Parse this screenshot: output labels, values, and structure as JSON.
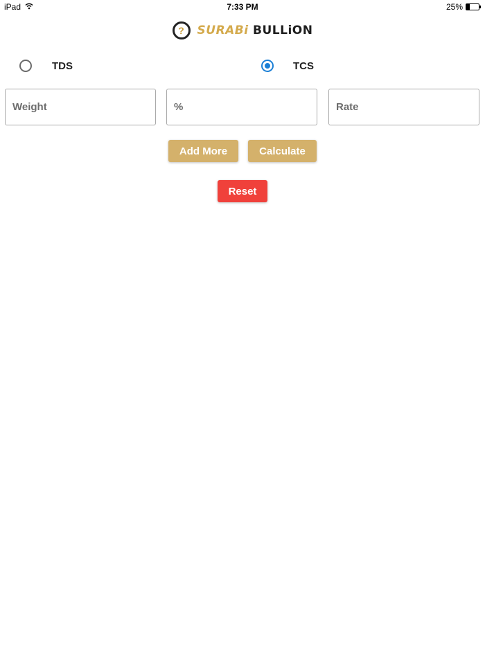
{
  "status_bar": {
    "device": "iPad",
    "time": "7:33 PM",
    "battery": "25%",
    "battery_level": 0.25,
    "wifi_icon": "wifi-icon"
  },
  "logo": {
    "mark_glyph": "?",
    "text_gold": "SURABi",
    "text_dark": "BULLiON",
    "colors": {
      "gold": "#d4aa4c",
      "dark": "#1e1e1e"
    }
  },
  "tax_type": {
    "options": [
      {
        "label": "TDS",
        "selected": false
      },
      {
        "label": "TCS",
        "selected": true
      }
    ],
    "selected_color": "#1a7fd6"
  },
  "fields": {
    "weight": {
      "placeholder": "Weight",
      "value": ""
    },
    "percent": {
      "placeholder": "%",
      "value": ""
    },
    "rate": {
      "placeholder": "Rate",
      "value": ""
    }
  },
  "buttons": {
    "add_more": "Add More",
    "calculate": "Calculate",
    "reset": "Reset",
    "colors": {
      "primary": "#d4b16b",
      "danger": "#f0413b"
    }
  }
}
